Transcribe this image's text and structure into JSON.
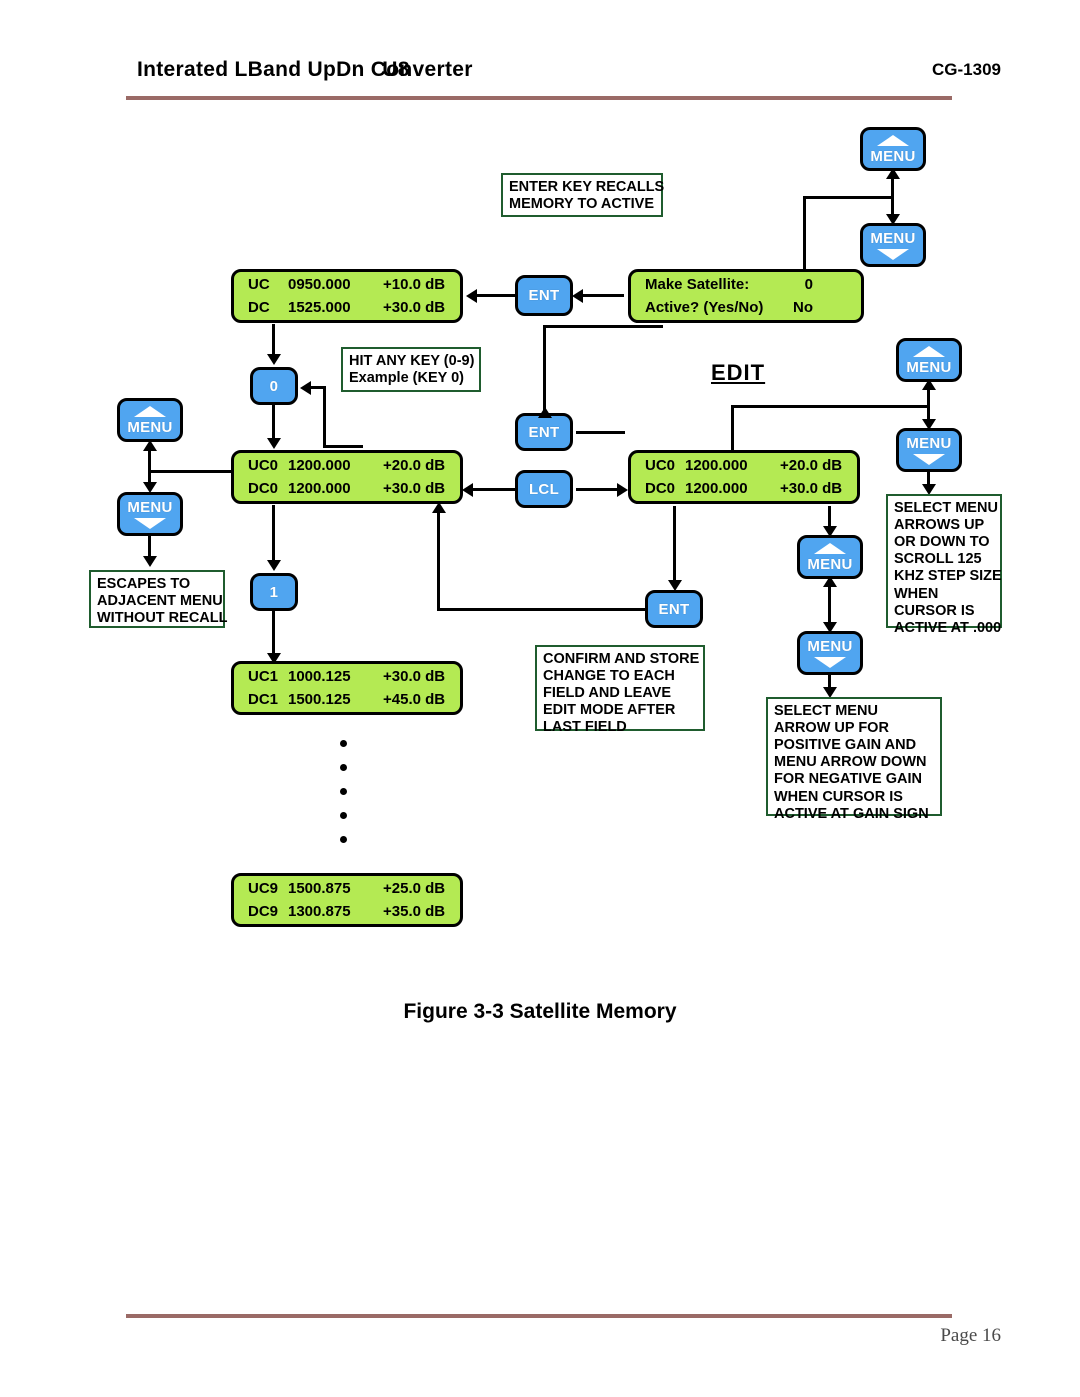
{
  "header": {
    "title_main": "Interated LBand UpDn C",
    "title_overlap_a": "on",
    "title_overlap_b": "U8",
    "title_tail": "verter",
    "doc_code": "CG-1309"
  },
  "footer": {
    "page_label": "Page 16"
  },
  "figure": {
    "caption": "Figure 3-3   Satellite Memory",
    "edit_label": "EDIT"
  },
  "displays": {
    "active": {
      "row1": {
        "ch": "UC",
        "freq": "0950.000",
        "gain": "+10.0 dB"
      },
      "row2": {
        "ch": "DC",
        "freq": "1525.000",
        "gain": "+30.0 dB"
      }
    },
    "make_satellite": {
      "row1": {
        "label": "Make Satellite:",
        "value": "0"
      },
      "row2": {
        "label": "Active? (Yes/No)",
        "value": "No"
      }
    },
    "mem0_left": {
      "row1": {
        "ch": "UC0",
        "freq": "1200.000",
        "gain": "+20.0 dB"
      },
      "row2": {
        "ch": "DC0",
        "freq": "1200.000",
        "gain": "+30.0 dB"
      }
    },
    "mem0_right": {
      "row1": {
        "ch": "UC0",
        "freq": "1200.000",
        "gain": "+20.0 dB"
      },
      "row2": {
        "ch": "DC0",
        "freq": "1200.000",
        "gain": "+30.0 dB"
      }
    },
    "mem1": {
      "row1": {
        "ch": "UC1",
        "freq": "1000.125",
        "gain": "+30.0 dB"
      },
      "row2": {
        "ch": "DC1",
        "freq": "1500.125",
        "gain": "+45.0 dB"
      }
    },
    "mem9": {
      "row1": {
        "ch": "UC9",
        "freq": "1500.875",
        "gain": "+25.0 dB"
      },
      "row2": {
        "ch": "DC9",
        "freq": "1300.875",
        "gain": "+35.0 dB"
      }
    }
  },
  "keys": {
    "menu_up": "MENU",
    "menu_down": "MENU",
    "ent": "ENT",
    "lcl": "LCL",
    "digit_0": "0",
    "digit_1": "1"
  },
  "notes": {
    "enter_recall": [
      "ENTER KEY RECALLS",
      "MEMORY TO ACTIVE"
    ],
    "hit_any_key": [
      "HIT ANY KEY (0-9)",
      "Example (KEY 0)"
    ],
    "escapes": [
      "ESCAPES TO",
      "ADJACENT MENU",
      "WITHOUT RECALL"
    ],
    "confirm_store": [
      "CONFIRM AND STORE",
      "CHANGE TO EACH",
      "FIELD AND LEAVE",
      "EDIT MODE AFTER",
      "LAST FIELD"
    ],
    "scroll_step": [
      "SELECT MENU",
      "ARROWS UP",
      "OR DOWN TO",
      "SCROLL 125",
      "KHZ STEP SIZE",
      "WHEN",
      "CURSOR IS",
      "ACTIVE AT .000"
    ],
    "gain_sign": [
      "SELECT MENU",
      "ARROW UP FOR",
      "POSITIVE GAIN AND",
      "MENU ARROW DOWN",
      "FOR NEGATIVE GAIN",
      "WHEN CURSOR IS",
      "ACTIVE AT GAIN SIGN"
    ]
  },
  "colors": {
    "lcd_green": "#b4ea53",
    "key_blue": "#50a5f0",
    "note_border": "#1f5c2e",
    "rule": "#9a6a66"
  }
}
